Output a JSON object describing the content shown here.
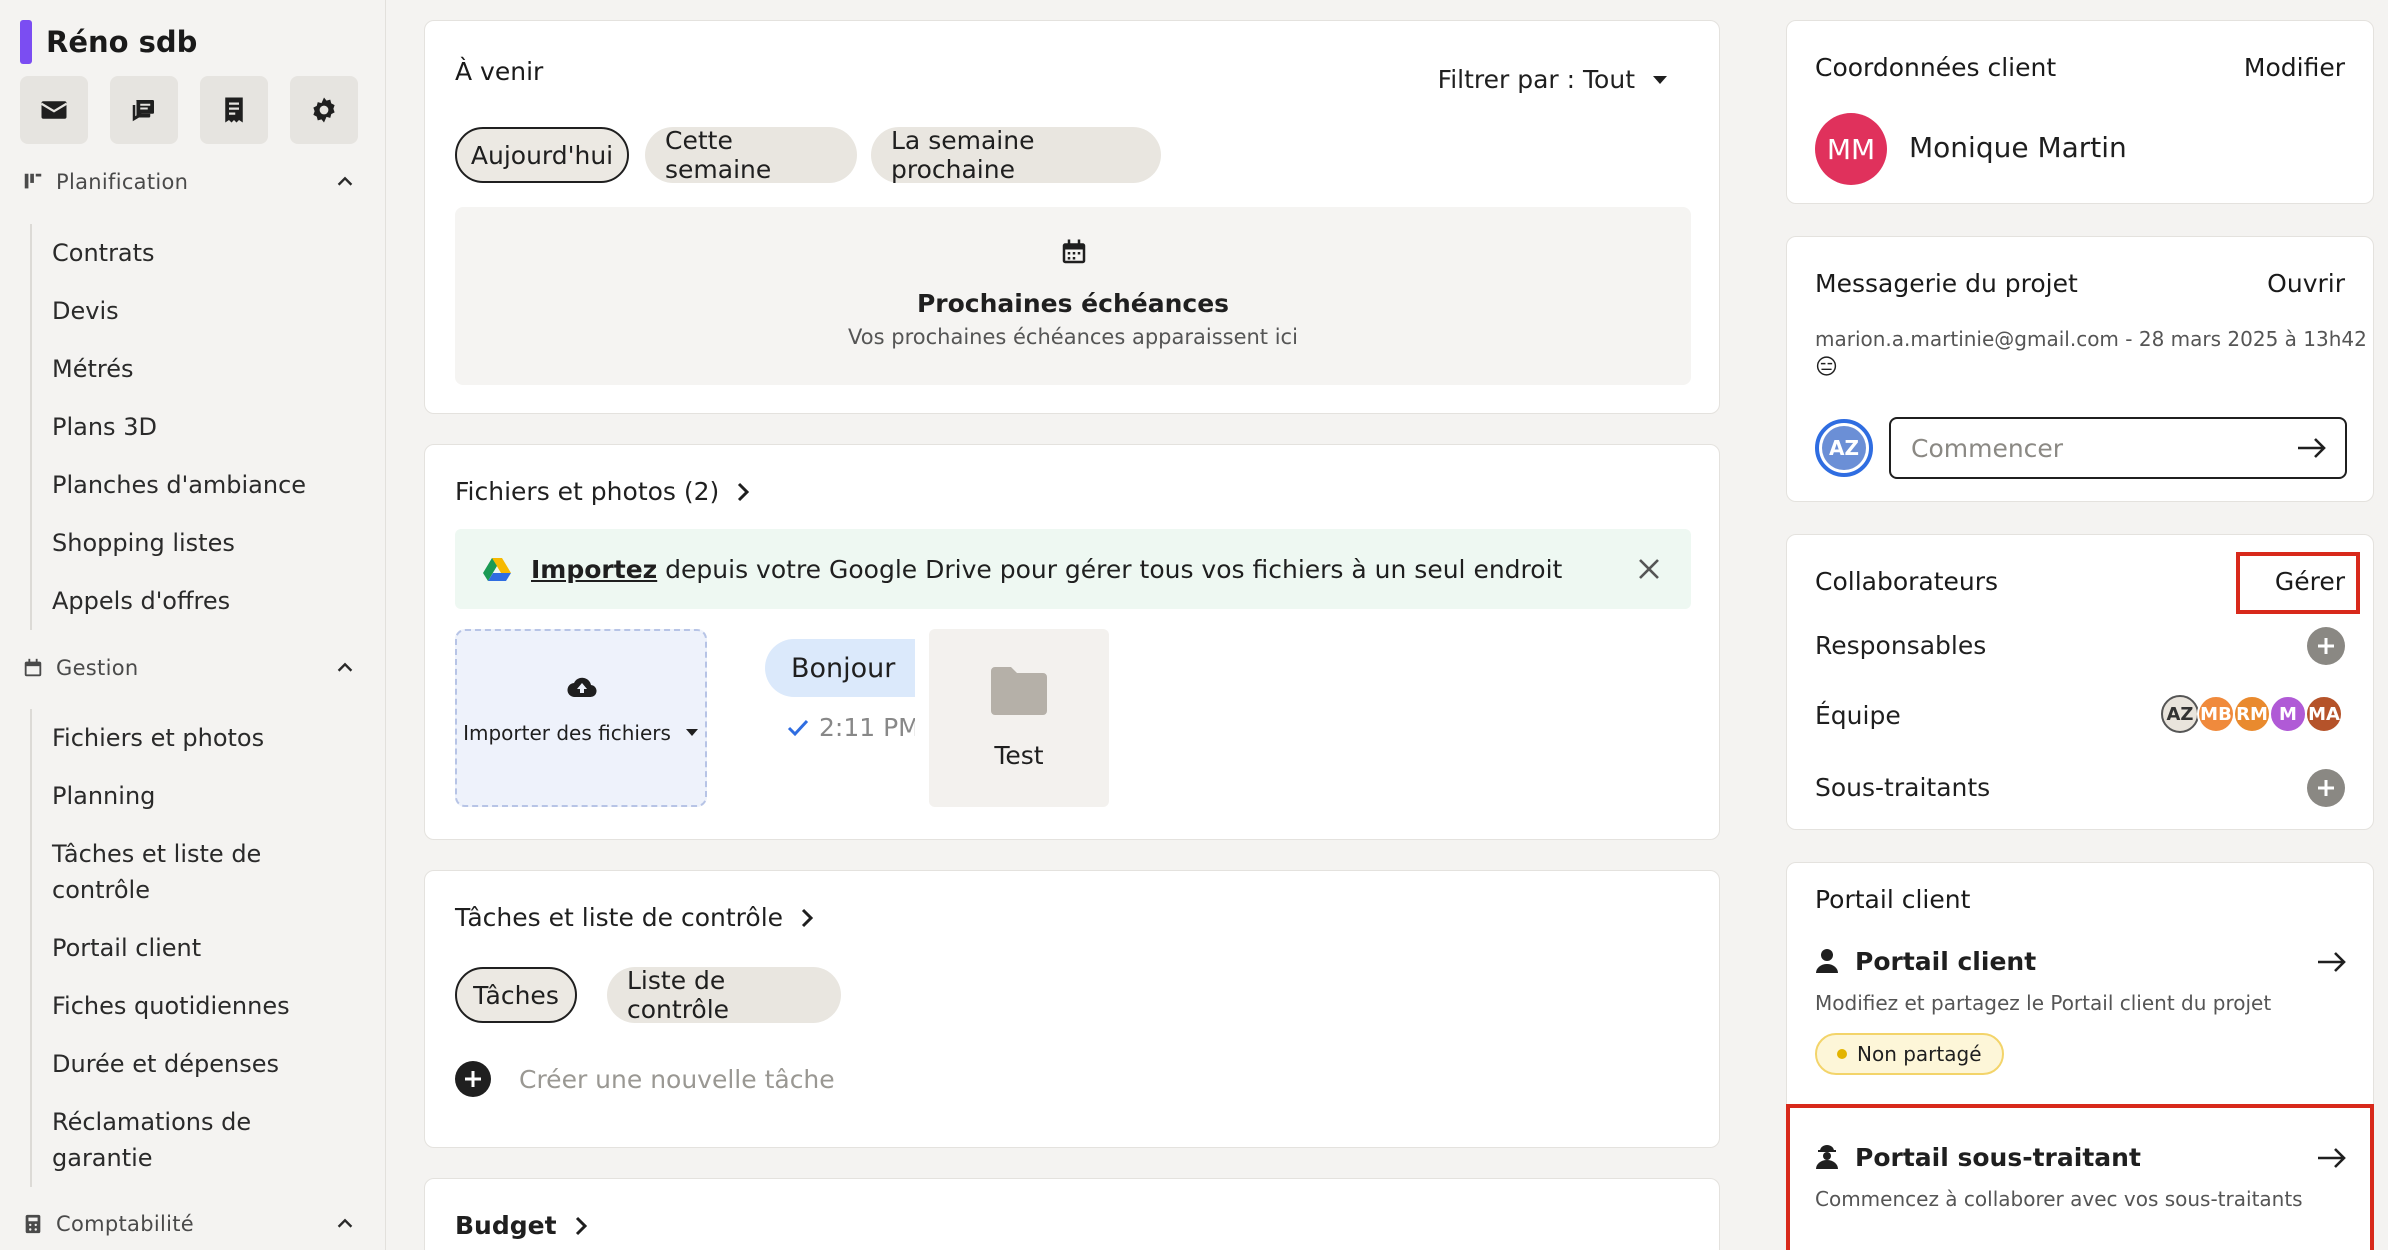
{
  "project": {
    "name": "Réno sdb",
    "accent": "#7b4df2"
  },
  "sidebar": {
    "quick_icons": [
      "mail-icon",
      "chat-bubbles-icon",
      "invoice-icon",
      "gear-icon"
    ],
    "sections": [
      {
        "label": "Planification",
        "icon": "planning-icon",
        "items": [
          "Contrats",
          "Devis",
          "Métrés",
          "Plans 3D",
          "Planches d'ambiance",
          "Shopping listes",
          "Appels d'offres"
        ]
      },
      {
        "label": "Gestion",
        "icon": "calendar-icon",
        "items": [
          "Fichiers et photos",
          "Planning",
          "Tâches et liste de contrôle",
          "Portail client",
          "Fiches quotidiennes",
          "Durée et dépenses",
          "Réclamations de garantie"
        ]
      },
      {
        "label": "Comptabilité",
        "icon": "calculator-icon",
        "items": []
      }
    ]
  },
  "upcoming": {
    "title": "À venir",
    "filter_label": "Filtrer par : Tout",
    "tabs": [
      "Aujourd'hui",
      "Cette semaine",
      "La semaine prochaine"
    ],
    "empty_title": "Prochaines échéances",
    "empty_text": "Vos prochaines échéances apparaissent ici"
  },
  "files": {
    "title": "Fichiers et photos (2)",
    "banner_link": "Importez",
    "banner_text": " depuis votre Google Drive pour gérer tous vos fichiers à un seul endroit",
    "upload_label": "Importer des fichiers",
    "chat_bubble": "Bonjour",
    "chat_time": "2:11 PM",
    "folder_name": "Test"
  },
  "tasks": {
    "title": "Tâches et liste de contrôle",
    "tabs": [
      "Tâches",
      "Liste de contrôle"
    ],
    "new_task_placeholder": "Créer une nouvelle tâche"
  },
  "budget": {
    "title": "Budget"
  },
  "client": {
    "title": "Coordonnées client",
    "action": "Modifier",
    "initials": "MM",
    "name": "Monique Martin",
    "avatar_color": "#e0315c"
  },
  "messaging": {
    "title": "Messagerie du projet",
    "action": "Ouvrir",
    "last_message": "marion.a.martinie@gmail.com - 28 mars 2025 à 13h42",
    "emoji": "😑",
    "user_initials": "AZ",
    "input_placeholder": "Commencer"
  },
  "collaborators": {
    "title": "Collaborateurs",
    "action": "Gérer",
    "rows": [
      {
        "label": "Responsables"
      },
      {
        "label": "Équipe"
      },
      {
        "label": "Sous-traitants"
      }
    ],
    "team_avatars": [
      {
        "initials": "AZ",
        "color": "#e9e4dc"
      },
      {
        "initials": "MB",
        "color": "#f08a3c"
      },
      {
        "initials": "RM",
        "color": "#e98a2e"
      },
      {
        "initials": "M",
        "color": "#b05ad6"
      },
      {
        "initials": "MA",
        "color": "#b5532a"
      }
    ]
  },
  "portal": {
    "section_title": "Portail client",
    "client_portal_title": "Portail client",
    "client_portal_desc": "Modifiez et partagez le Portail client du projet",
    "status_badge": "Non partagé",
    "sub_portal_title": "Portail sous-traitant",
    "sub_portal_desc": "Commencez à collaborer avec vos sous-traitants"
  },
  "highlight_color": "#d8291b"
}
